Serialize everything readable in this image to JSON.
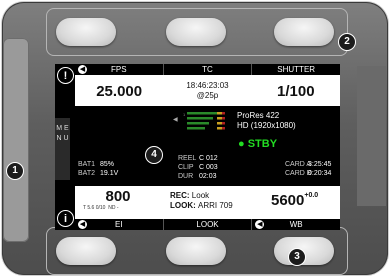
{
  "top_tabs": [
    "FPS",
    "TC",
    "SHUTTER"
  ],
  "fps": {
    "value": "25.000"
  },
  "tc": {
    "time": "18:46:23:03",
    "rate": "@25p"
  },
  "shutter": {
    "value": "1/100"
  },
  "codec": {
    "line1": "ProRes 422",
    "line2": "HD (1920x1080)"
  },
  "status": "STBY",
  "batt": {
    "bat1_label": "BAT1",
    "bat1_value": "85%",
    "bat2_label": "BAT2",
    "bat2_value": "19.1V"
  },
  "clip": {
    "reel_label": "REEL",
    "reel": "C 012",
    "clip_label": "CLIP",
    "clip": "C 003",
    "dur_label": "DUR",
    "dur": "02:03"
  },
  "cards": {
    "a_label": "CARD A",
    "a_value": "3:25:45",
    "b_label": "CARD B",
    "b_value": "0:20:34"
  },
  "ei": {
    "value": "800",
    "sub": "T 5.6  0/10",
    "nd": "ND  -"
  },
  "look": {
    "rec_label": "REC:",
    "rec_value": "Look",
    "look_label": "LOOK:",
    "look_value": "ARRI 709"
  },
  "wb": {
    "value": "5600",
    "tint": "+0.0"
  },
  "bottom_tabs": [
    "EI",
    "LOOK",
    "WB"
  ],
  "menu": {
    "label": "M E N U"
  },
  "left_icons": {
    "warning": "!",
    "info": "i"
  },
  "markers": [
    "1",
    "2",
    "3",
    "4"
  ]
}
